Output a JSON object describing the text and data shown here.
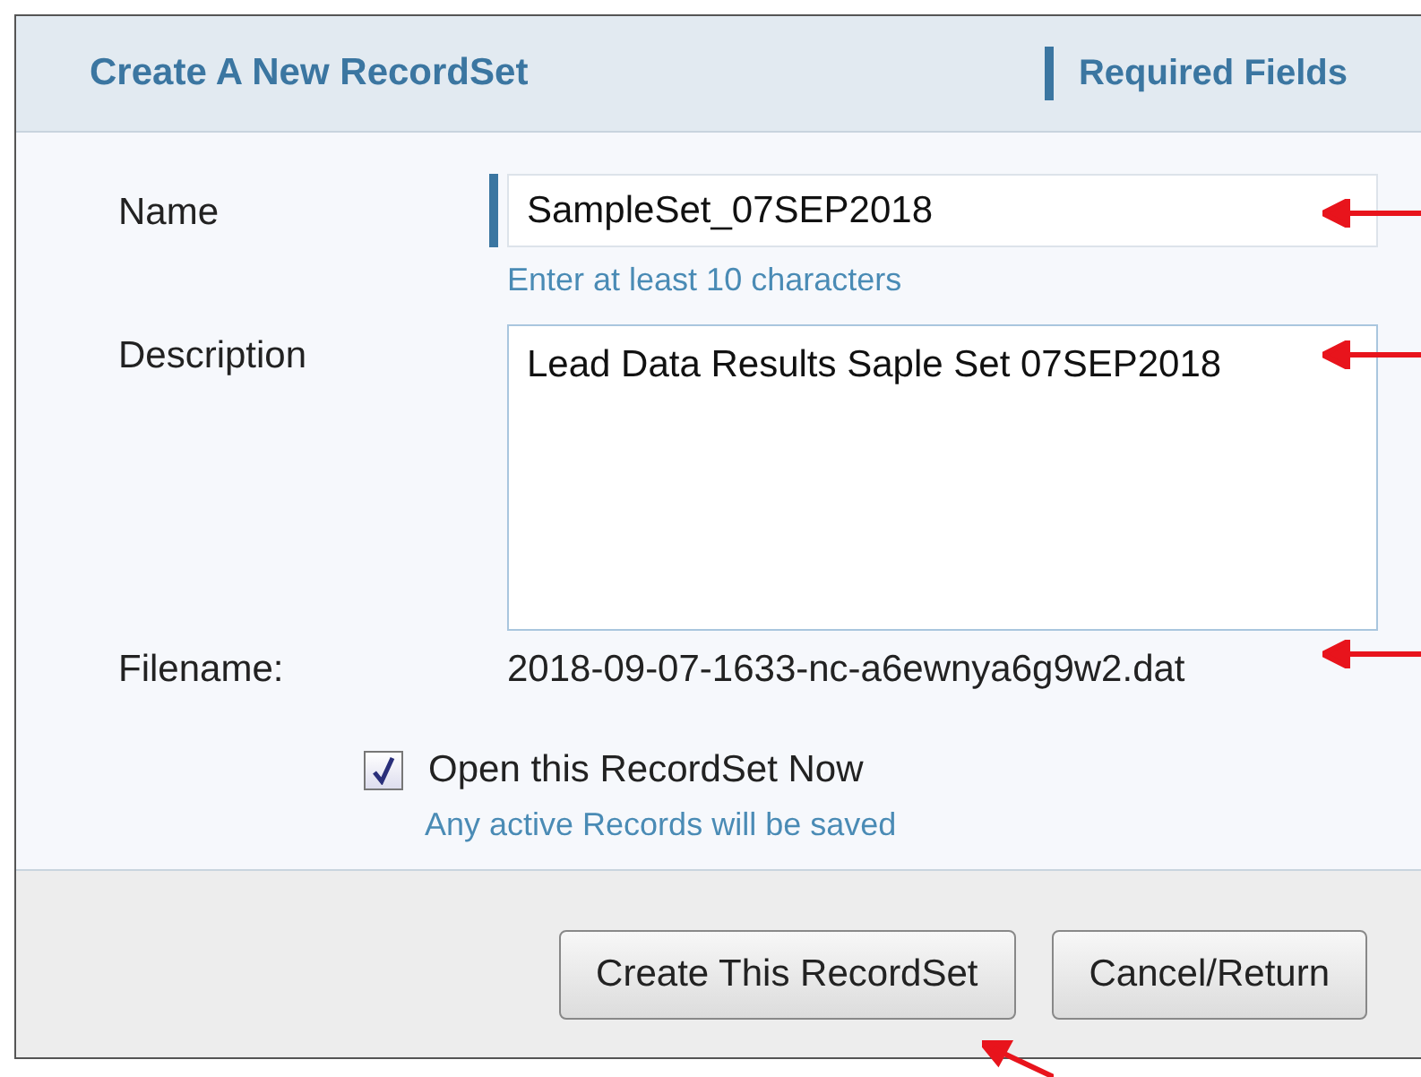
{
  "dialog": {
    "title": "Create A New RecordSet",
    "required_label": "Required Fields"
  },
  "fields": [
    {
      "label": "Name",
      "kind": "input",
      "value": "SampleSet_07SEP2018",
      "required": true,
      "hint": "Enter at least 10 characters"
    },
    {
      "label": "Description",
      "kind": "textarea",
      "value": "Lead Data Results Saple Set 07SEP2018",
      "required": false
    },
    {
      "label": "Filename:",
      "kind": "text",
      "value": "2018-09-07-1633-nc-a6ewnya6g9w2.dat",
      "required": false
    }
  ],
  "open_option": {
    "label": "Open this RecordSet Now",
    "checked": true,
    "hint": "Any active Records will be saved"
  },
  "buttons": [
    "Create This RecordSet",
    "Cancel/Return"
  ]
}
